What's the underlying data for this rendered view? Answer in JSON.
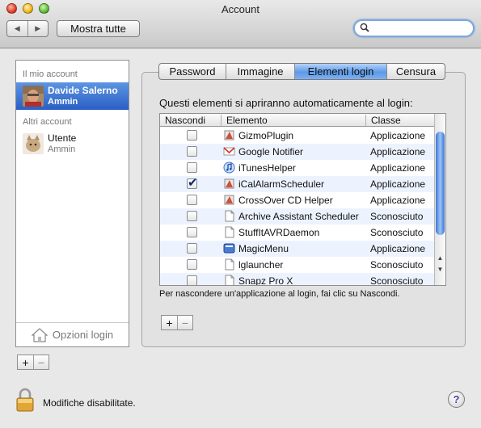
{
  "window": {
    "title": "Account"
  },
  "toolbar": {
    "back_glyph": "◀",
    "forward_glyph": "▶",
    "show_all": "Mostra tutte",
    "search_value": "",
    "search_placeholder": ""
  },
  "sidebar": {
    "my_account_label": "Il mio account",
    "my_account": {
      "name": "Davide Salerno",
      "role": "Ammin"
    },
    "other_accounts_label": "Altri account",
    "other_accounts": [
      {
        "name": "Utente",
        "role": "Ammin"
      }
    ],
    "login_options": "Opzioni login",
    "add": "+",
    "remove": "−"
  },
  "tabs": [
    {
      "label": "Password",
      "active": false
    },
    {
      "label": "Immagine",
      "active": false
    },
    {
      "label": "Elementi login",
      "active": true
    },
    {
      "label": "Censura",
      "active": false
    }
  ],
  "login_items": {
    "intro": "Questi elementi si apriranno automaticamente al login:",
    "columns": {
      "hide": "Nascondi",
      "item": "Elemento",
      "class": "Classe"
    },
    "rows": [
      {
        "hide": false,
        "name": "GizmoPlugin",
        "class": "Applicazione",
        "icon": "app-icon"
      },
      {
        "hide": false,
        "name": "Google Notifier",
        "class": "Applicazione",
        "icon": "gmail-icon"
      },
      {
        "hide": false,
        "name": "iTunesHelper",
        "class": "Applicazione",
        "icon": "itunes-icon"
      },
      {
        "hide": true,
        "name": "iCalAlarmScheduler",
        "class": "Applicazione",
        "icon": "app-icon"
      },
      {
        "hide": false,
        "name": "CrossOver CD Helper",
        "class": "Applicazione",
        "icon": "app-icon"
      },
      {
        "hide": false,
        "name": "Archive Assistant Scheduler",
        "class": "Sconosciuto",
        "icon": "document-icon"
      },
      {
        "hide": false,
        "name": "StuffItAVRDaemon",
        "class": "Sconosciuto",
        "icon": "document-icon"
      },
      {
        "hide": false,
        "name": "MagicMenu",
        "class": "Applicazione",
        "icon": "magicmenu-icon"
      },
      {
        "hide": false,
        "name": "lglauncher",
        "class": "Sconosciuto",
        "icon": "document-icon"
      },
      {
        "hide": false,
        "name": "Snapz Pro X",
        "class": "Sconosciuto",
        "icon": "document-icon"
      }
    ],
    "hint": "Per nascondere un'applicazione al login, fai clic su Nascondi.",
    "add": "+",
    "remove": "−"
  },
  "footer": {
    "lock_status": "Modifiche disabilitate.",
    "help": "?"
  },
  "colors": {
    "selection": "#3b74d2",
    "row_alt": "#edf3fe",
    "tab_active": "#5d9ae9"
  }
}
